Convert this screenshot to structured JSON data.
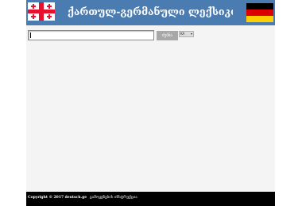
{
  "header": {
    "title": "ქართულ-გერმანული  ლექსიკონი",
    "background_color": "#4a7bb1",
    "left_flag": "georgia-flag",
    "right_flag": "germany-flag"
  },
  "search": {
    "input_value": "",
    "placeholder": "",
    "button_label": "ძებნა",
    "language_selected": "KA",
    "button_color": "#a8a8a8"
  },
  "footer": {
    "copyright": "Copyright © 2017 deutsch.ge",
    "link_label": "გამოყენების ინსტრუქცია",
    "background_color": "#000000"
  },
  "colors": {
    "page_background": "#f4f4f4",
    "title_text": "#ffffff"
  }
}
